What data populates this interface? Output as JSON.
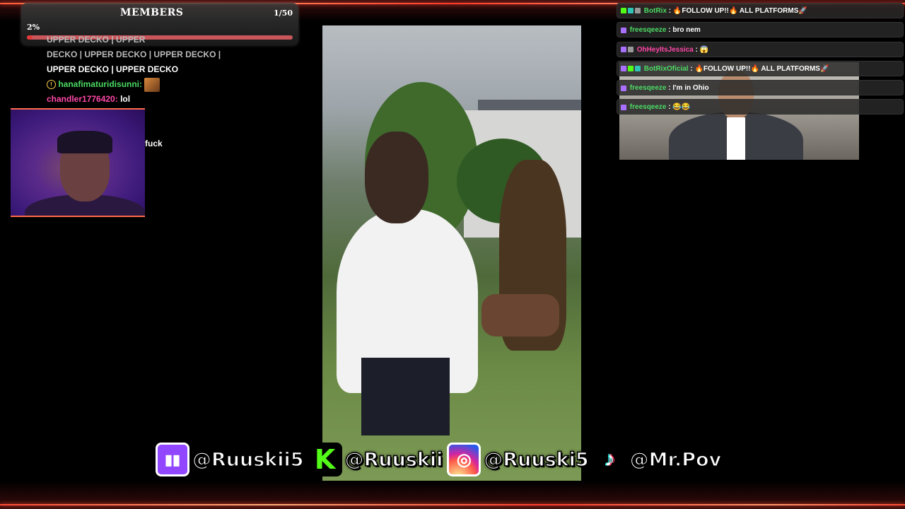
{
  "members": {
    "title": "MEMBERS",
    "count": "1/50",
    "percent": "2%",
    "progress_fraction": 0.02
  },
  "left_chat": {
    "lines": [
      "UPPER DECKO | UPPER",
      "DECKO | UPPER DECKO | UPPER DECKO |",
      "UPPER DECKO | UPPER DECKO"
    ],
    "msg1_user": "hanafimaturidisunni:",
    "msg2_user": "chandler1776420:",
    "msg2_text": "lol",
    "msg3_text": "fuck"
  },
  "right_chat": [
    {
      "user": "BotRix",
      "text": "🔥FOLLOW UP!!🔥 ALL PLATFORMS🚀",
      "color": "#4cdb64"
    },
    {
      "user": "freesqeeze",
      "text": "bro nem",
      "color": "#4cdb64"
    },
    {
      "user": "OhHeyItsJessica",
      "text": "😱",
      "color": "#ff47a8"
    },
    {
      "user": "BotRixOficial",
      "text": "🔥FOLLOW UP!!🔥 ALL PLATFORMS🚀",
      "color": "#4cdb64"
    },
    {
      "user": "freesqeeze",
      "text": "I'm in Ohio",
      "color": "#4cdb64"
    },
    {
      "user": "freesqeeze",
      "text": "😂😂",
      "color": "#4cdb64"
    }
  ],
  "socials": {
    "twitch": "@Ruuskii5",
    "kick": "@Ruuskii",
    "instagram": "@Ruuski5",
    "tiktok": "@Mr.Pov"
  },
  "colors": {
    "accent": "#ff4b33",
    "twitch": "#9146ff",
    "kick": "#53fc18"
  }
}
